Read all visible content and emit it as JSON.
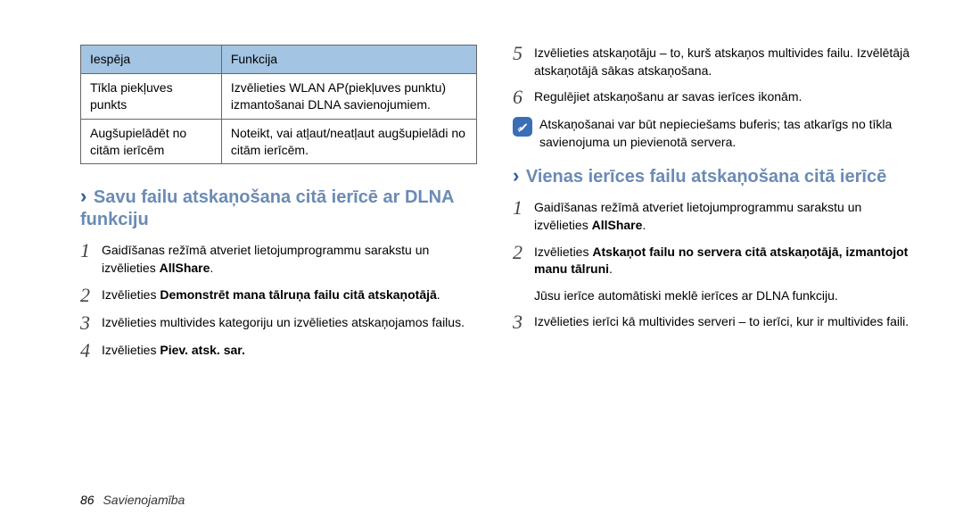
{
  "table": {
    "head": {
      "opt": "Iespēja",
      "func": "Funkcija"
    },
    "rows": [
      {
        "opt": "Tīkla piekļuves punkts",
        "func": "Izvēlieties WLAN AP(piekļuves punktu) izmantošanai DLNA savienojumiem."
      },
      {
        "opt": "Augšupielādēt no citām ierīcēm",
        "func": "Noteikt, vai atļaut/neatļaut augšupielādi no citām ierīcēm."
      }
    ]
  },
  "leftTitleChevron": "›",
  "leftTitle": "Savu failu atskaņošana citā ierīcē ar DLNA funkciju",
  "leftSteps": [
    {
      "n": "1",
      "html": "Gaidīšanas režīmā atveriet lietojumprogrammu sarakstu un izvēlieties <b>AllShare</b>."
    },
    {
      "n": "2",
      "html": "Izvēlieties <b>Demonstrēt mana tālruņa failu citā atskaņotājā</b>."
    },
    {
      "n": "3",
      "html": "Izvēlieties multivides kategoriju un izvēlieties atskaņojamos failus."
    },
    {
      "n": "4",
      "html": "Izvēlieties <b>Piev. atsk. sar.</b>"
    }
  ],
  "rightTop": [
    {
      "n": "5",
      "html": "Izvēlieties atskaņotāju – to, kurš atskaņos multivides failu. Izvēlētājā atskaņotājā sākas atskaņošana."
    },
    {
      "n": "6",
      "html": "Regulējiet atskaņošanu ar savas ierīces ikonām."
    }
  ],
  "note": "Atskaņošanai var būt nepieciešams buferis; tas atkarīgs no tīkla savienojuma un pievienotā servera.",
  "rightTitleChevron": "›",
  "rightTitle": "Vienas ierīces failu atskaņošana citā ierīcē",
  "rightSteps": [
    {
      "n": "1",
      "html": "Gaidīšanas režīmā atveriet lietojumprogrammu sarakstu un izvēlieties <b>AllShare</b>."
    },
    {
      "n": "2",
      "html": "Izvēlieties <b>Atskaņot failu no servera citā atskaņotājā, izmantojot manu tālruni</b>."
    }
  ],
  "aux": "Jūsu ierīce automātiski meklē ierīces ar DLNA funkciju.",
  "rightSteps2": [
    {
      "n": "3",
      "html": "Izvēlieties ierīci kā multivides serveri – to ierīci, kur ir multivides faili."
    }
  ],
  "footer": {
    "page": "86",
    "section": "Savienojamība"
  }
}
